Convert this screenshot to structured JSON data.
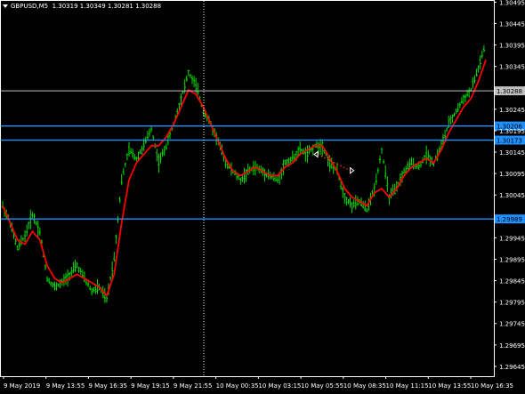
{
  "window": {
    "symbol": "GBPUSD,M5",
    "ohlc": "1.30319 1.30349 1.30281 1.30288"
  },
  "colors": {
    "background": "#000000",
    "candles": "#00dd00",
    "ma": "#ff0000",
    "hline": "#1e90ff",
    "price_line": "#c0c0c0",
    "axis_text": "#ffffff",
    "bid_label_bg": "#1e90ff",
    "ask_label_bg": "#c0c0c0"
  },
  "chart_data": {
    "type": "line",
    "title": "GBPUSD,M5",
    "xlabel": "",
    "ylabel": "",
    "ylim": [
      1.29622,
      1.305
    ],
    "y_ticks": [
      "1.30495",
      "1.30445",
      "1.30395",
      "1.30345",
      "1.30288",
      "1.30245",
      "1.30206",
      "1.30195",
      "1.30173",
      "1.30145",
      "1.30095",
      "1.30045",
      "1.29989",
      "1.29945",
      "1.29895",
      "1.29845",
      "1.29795",
      "1.29745",
      "1.29695",
      "1.29645"
    ],
    "x_ticks": [
      "9 May 2019",
      "9 May 13:55",
      "9 May 16:35",
      "9 May 19:15",
      "9 May 21:55",
      "10 May 00:35",
      "10 May 03:15",
      "10 May 05:55",
      "10 May 08:35",
      "10 May 11:15",
      "10 May 13:55",
      "10 May 16:35"
    ],
    "horizontal_lines": [
      {
        "value": 1.30206,
        "label": "1.30206"
      },
      {
        "value": 1.30173,
        "label": "1.30173"
      },
      {
        "value": 1.29989,
        "label": "1.29989"
      }
    ],
    "current_price": {
      "value": 1.30288,
      "label": "1.30288"
    },
    "series": [
      {
        "name": "price",
        "values": [
          1.3002,
          1.2998,
          1.2992,
          1.2995,
          1.3,
          1.2996,
          1.2985,
          1.2983,
          1.2984,
          1.2986,
          1.2988,
          1.2985,
          1.2982,
          1.2983,
          1.298,
          1.299,
          1.3008,
          1.3015,
          1.3013,
          1.3016,
          1.302,
          1.3012,
          1.3016,
          1.3021,
          1.3027,
          1.3033,
          1.303,
          1.3024,
          1.3021,
          1.3017,
          1.3012,
          1.301,
          1.3008,
          1.301,
          1.3011,
          1.301,
          1.3009,
          1.3008,
          1.3012,
          1.3013,
          1.3015,
          1.3014,
          1.3016,
          1.3016,
          1.3012,
          1.301,
          1.3004,
          1.3002,
          1.3003,
          1.3001,
          1.3006,
          1.3015,
          1.3004,
          1.3006,
          1.301,
          1.3012,
          1.3011,
          1.3014,
          1.3012,
          1.3016,
          1.3021,
          1.3024,
          1.3027,
          1.3029,
          1.3034,
          1.304
        ]
      },
      {
        "name": "moving average",
        "values": [
          1.3002,
          1.2998,
          1.2994,
          1.2993,
          1.2996,
          1.2994,
          1.2988,
          1.2985,
          1.2984,
          1.2985,
          1.2986,
          1.2985,
          1.2984,
          1.2983,
          1.2981,
          1.2986,
          1.2998,
          1.3008,
          1.3012,
          1.3014,
          1.3016,
          1.3016,
          1.3018,
          1.3021,
          1.3025,
          1.3029,
          1.3028,
          1.3025,
          1.3021,
          1.3017,
          1.3013,
          1.301,
          1.3009,
          1.301,
          1.3011,
          1.301,
          1.3009,
          1.3009,
          1.3011,
          1.3012,
          1.3014,
          1.3015,
          1.3016,
          1.3016,
          1.3013,
          1.301,
          1.3006,
          1.3004,
          1.3003,
          1.3002,
          1.3005,
          1.3006,
          1.3004,
          1.3006,
          1.3009,
          1.3011,
          1.3012,
          1.3013,
          1.3012,
          1.3015,
          1.3019,
          1.3022,
          1.3025,
          1.3027,
          1.3031,
          1.3036
        ]
      }
    ]
  }
}
